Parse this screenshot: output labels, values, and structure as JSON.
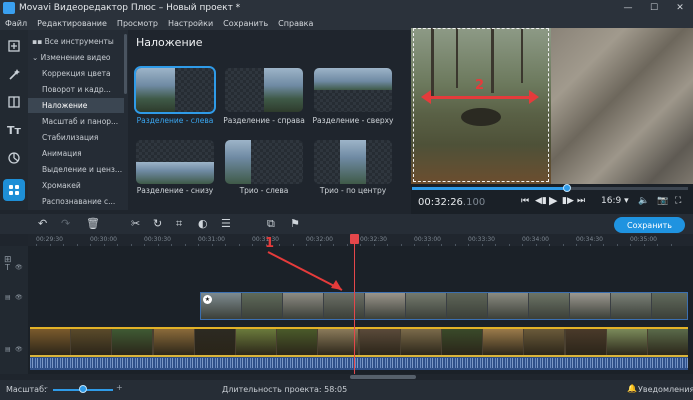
{
  "window": {
    "title": "Movavi Видеоредактор Плюс – Новый проект *",
    "min": "—",
    "max": "☐",
    "close": "✕"
  },
  "menu": [
    "Файл",
    "Редактирование",
    "Просмотр",
    "Настройки",
    "Сохранить",
    "Справка"
  ],
  "left_tools": [
    "import-icon",
    "magic-wand-icon",
    "transitions-icon",
    "titles-icon",
    "stickers-icon",
    "more-tools-icon"
  ],
  "categories": {
    "all_tools": "Все инструменты",
    "video_edit": "Изменение видео",
    "items": [
      "Коррекция цвета",
      "Поворот и кадр...",
      "Наложение",
      "Масштаб и панор...",
      "Стабилизация",
      "Анимация",
      "Выделение и ценз...",
      "Хромакей",
      "Распознавание с..."
    ],
    "active": "Наложение"
  },
  "overlay": {
    "title": "Наложение",
    "presets": [
      "Разделение - слева",
      "Разделение - справа",
      "Разделение - сверху",
      "Разделение - снизу",
      "Трио - слева",
      "Трио - по центру"
    ],
    "selected": "Разделение - слева"
  },
  "preview": {
    "annotation": "2",
    "timecode": "00:32:26",
    "timecode_ms": ".100",
    "aspect": "16:9 ▾",
    "progress": 0.56
  },
  "toolbar": {
    "save_label": "Сохранить"
  },
  "ruler": [
    "00:29:30",
    "00:30:00",
    "00:30:30",
    "00:31:00",
    "00:31:30",
    "00:32:00",
    "00:32:30",
    "00:33:00",
    "00:33:30",
    "00:34:00",
    "00:34:30",
    "00:35:00"
  ],
  "timeline_annotation": "1",
  "status": {
    "scale_label": "Масштаб:",
    "duration_label": "Длительность проекта: 58:05",
    "notifications": "Уведомления"
  },
  "colors": {
    "accent": "#1f93e0",
    "playhead": "#e5474b",
    "annotation": "#e53b3b",
    "clip_border": "#e3b227",
    "audio": "#2e4f88"
  }
}
